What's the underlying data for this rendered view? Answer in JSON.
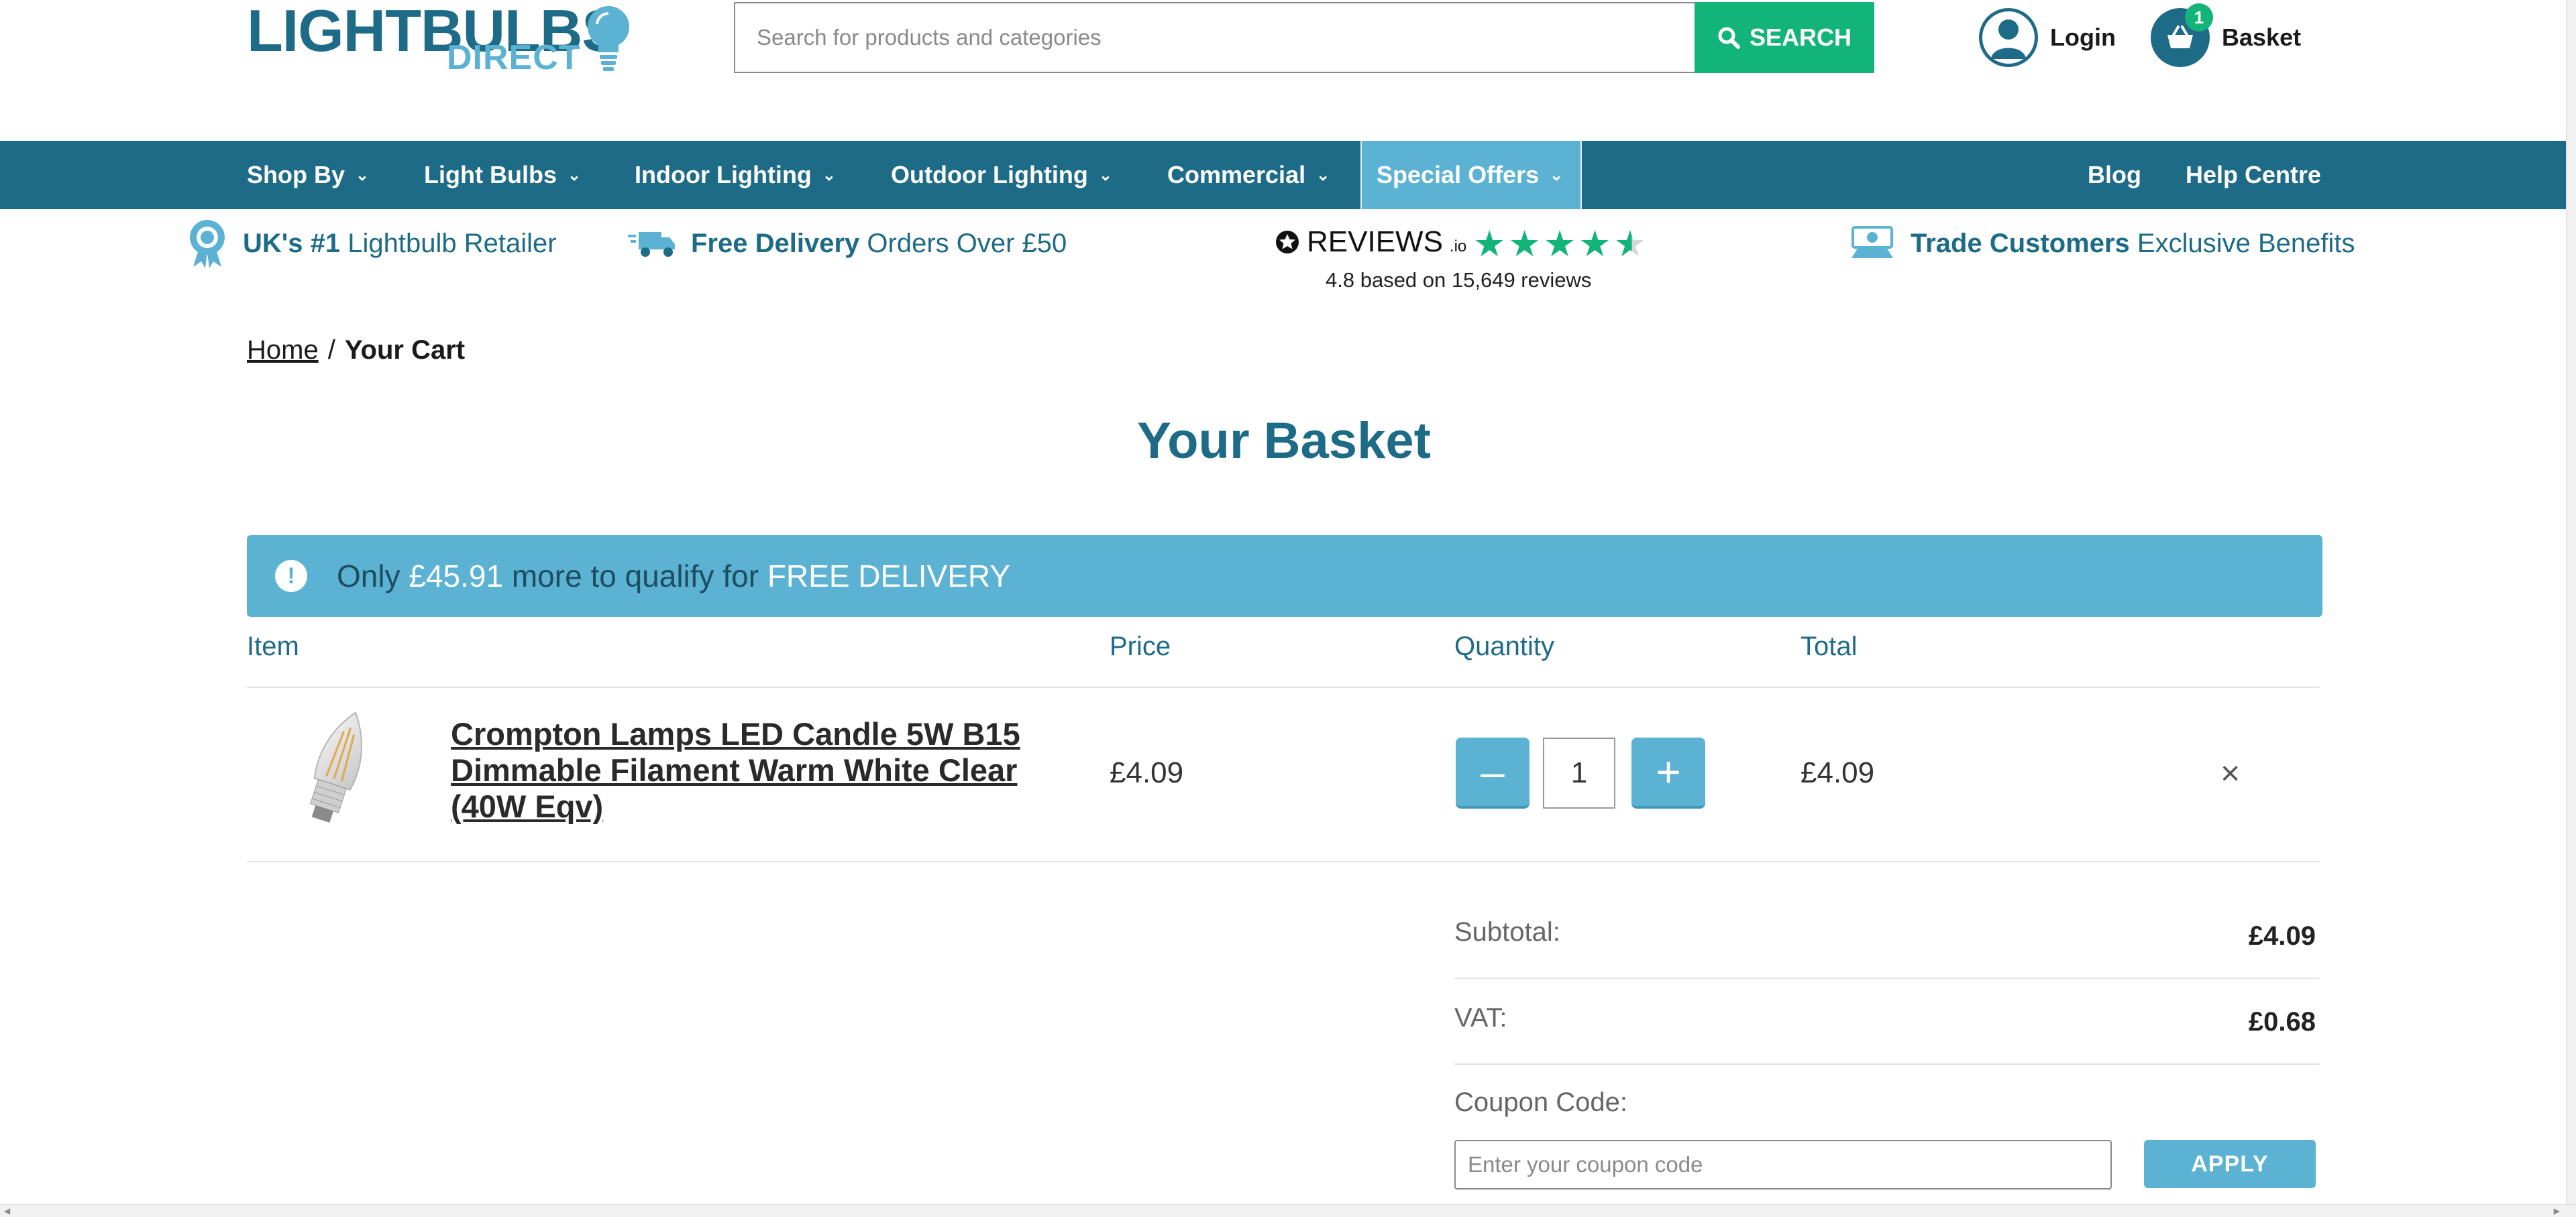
{
  "header": {
    "logo_top": "LIGHTBULBS",
    "logo_bottom": "DIRECT",
    "search_placeholder": "Search for products and categories",
    "search_button": "SEARCH",
    "login_label": "Login",
    "basket_label": "Basket",
    "basket_count": "1"
  },
  "nav": {
    "items": [
      {
        "label": "Shop By"
      },
      {
        "label": "Light Bulbs"
      },
      {
        "label": "Indoor Lighting"
      },
      {
        "label": "Outdoor Lighting"
      },
      {
        "label": "Commercial"
      },
      {
        "label": "Special Offers"
      }
    ],
    "blog": "Blog",
    "help": "Help Centre"
  },
  "usp": {
    "retailer_bold": "UK's #1",
    "retailer_text": "Lightbulb Retailer",
    "delivery_bold": "Free Delivery",
    "delivery_text": "Orders Over £50",
    "reviews_brand": "REVIEWS",
    "reviews_suffix": ".io",
    "rating": 4.8,
    "reviews_summary": "4.8 based on 15,649 reviews",
    "trade_bold": "Trade Customers",
    "trade_text": "Exclusive Benefits"
  },
  "breadcrumb": {
    "home": "Home",
    "separator": "/",
    "current": "Your Cart"
  },
  "page_title": "Your Basket",
  "alert": {
    "prefix": "Only",
    "amount": "£45.91",
    "middle": "more to qualify for",
    "highlight": "FREE DELIVERY"
  },
  "table": {
    "headers": {
      "item": "Item",
      "price": "Price",
      "quantity": "Quantity",
      "total": "Total"
    },
    "rows": [
      {
        "name": "Crompton Lamps LED Candle 5W B15 Dimmable Filament Warm White Clear (40W Eqv)",
        "price": "£4.09",
        "quantity": "1",
        "total": "£4.09",
        "remove_icon": "×"
      }
    ]
  },
  "summary": {
    "subtotal_label": "Subtotal:",
    "subtotal_value": "£4.09",
    "vat_label": "VAT:",
    "vat_value": "£0.68",
    "coupon_label": "Coupon Code:",
    "coupon_placeholder": "Enter your coupon code",
    "apply_button": "APPLY"
  },
  "colors": {
    "primary": "#1d6b87",
    "accent": "#5bb2d2",
    "green": "#12b479"
  }
}
